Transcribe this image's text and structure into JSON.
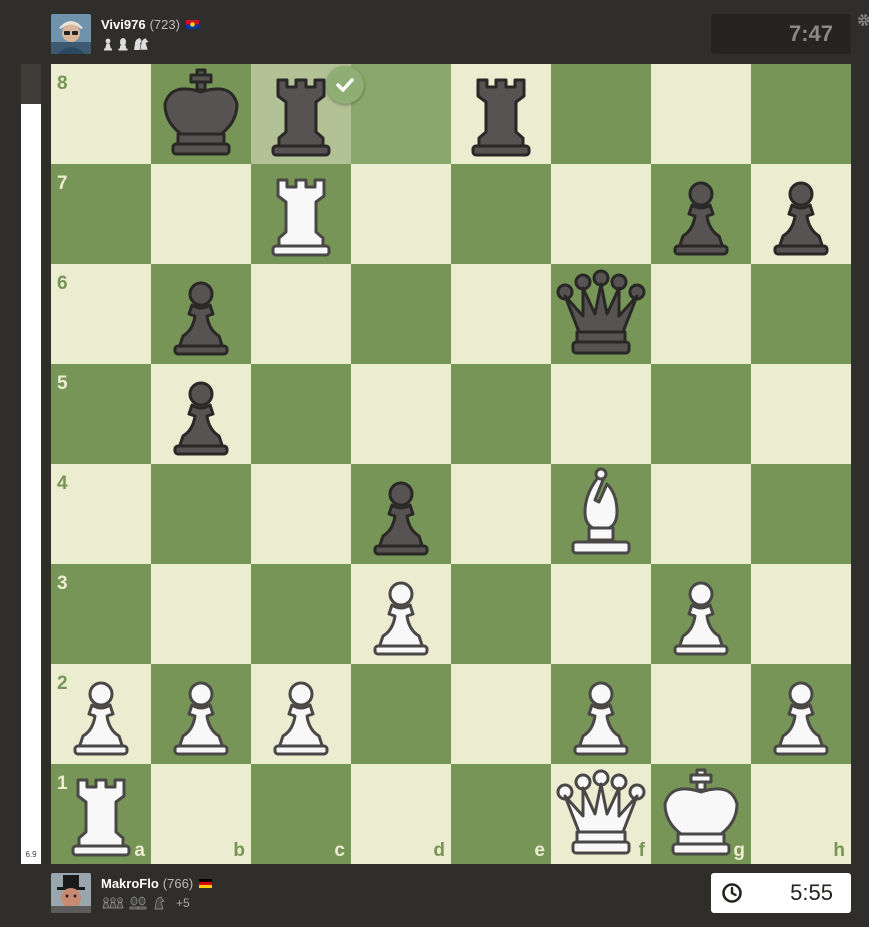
{
  "top_player": {
    "name": "Vivi976",
    "rating": "(723)",
    "flag_colors": [
      "#ce1126",
      "#fcd116",
      "#0038a8"
    ],
    "captured_icons": [
      "pawn-icon",
      "bishop-icon",
      "knight-icon"
    ],
    "clock": "7:47"
  },
  "bottom_player": {
    "name": "MakroFlo",
    "rating": "(766)",
    "flag_colors": [
      "#000000",
      "#dd0000",
      "#ffce00"
    ],
    "captured_icons": [
      "pawn-icon",
      "pawn-icon",
      "pawn-icon",
      "bishop-icon",
      "bishop-icon",
      "knight-icon"
    ],
    "material_advantage": "+5",
    "clock": "5:55"
  },
  "eval": {
    "score": "6.9",
    "white_fraction": 0.95
  },
  "board": {
    "colors": {
      "light": "#ebecd0",
      "dark": "#779556",
      "highlight_light": "#b3c197",
      "highlight_dark": "#89a86b"
    },
    "rank_labels": [
      "8",
      "7",
      "6",
      "5",
      "4",
      "3",
      "2",
      "1"
    ],
    "file_labels": [
      "a",
      "b",
      "c",
      "d",
      "e",
      "f",
      "g",
      "h"
    ],
    "highlighted_squares": [
      "c8",
      "d8"
    ],
    "move_marker": {
      "square": "c8",
      "icon": "checkmark-icon"
    },
    "pieces": [
      {
        "square": "b8",
        "color": "black",
        "type": "king"
      },
      {
        "square": "c8",
        "color": "black",
        "type": "rook"
      },
      {
        "square": "e8",
        "color": "black",
        "type": "rook"
      },
      {
        "square": "c7",
        "color": "white",
        "type": "rook"
      },
      {
        "square": "g7",
        "color": "black",
        "type": "pawn"
      },
      {
        "square": "h7",
        "color": "black",
        "type": "pawn"
      },
      {
        "square": "b6",
        "color": "black",
        "type": "pawn"
      },
      {
        "square": "f6",
        "color": "black",
        "type": "queen"
      },
      {
        "square": "b5",
        "color": "black",
        "type": "pawn"
      },
      {
        "square": "d4",
        "color": "black",
        "type": "pawn"
      },
      {
        "square": "f4",
        "color": "white",
        "type": "bishop"
      },
      {
        "square": "d3",
        "color": "white",
        "type": "pawn"
      },
      {
        "square": "g3",
        "color": "white",
        "type": "pawn"
      },
      {
        "square": "a2",
        "color": "white",
        "type": "pawn"
      },
      {
        "square": "b2",
        "color": "white",
        "type": "pawn"
      },
      {
        "square": "c2",
        "color": "white",
        "type": "pawn"
      },
      {
        "square": "f2",
        "color": "white",
        "type": "pawn"
      },
      {
        "square": "h2",
        "color": "white",
        "type": "pawn"
      },
      {
        "square": "a1",
        "color": "white",
        "type": "rook"
      },
      {
        "square": "f1",
        "color": "white",
        "type": "queen"
      },
      {
        "square": "g1",
        "color": "white",
        "type": "king"
      }
    ]
  }
}
